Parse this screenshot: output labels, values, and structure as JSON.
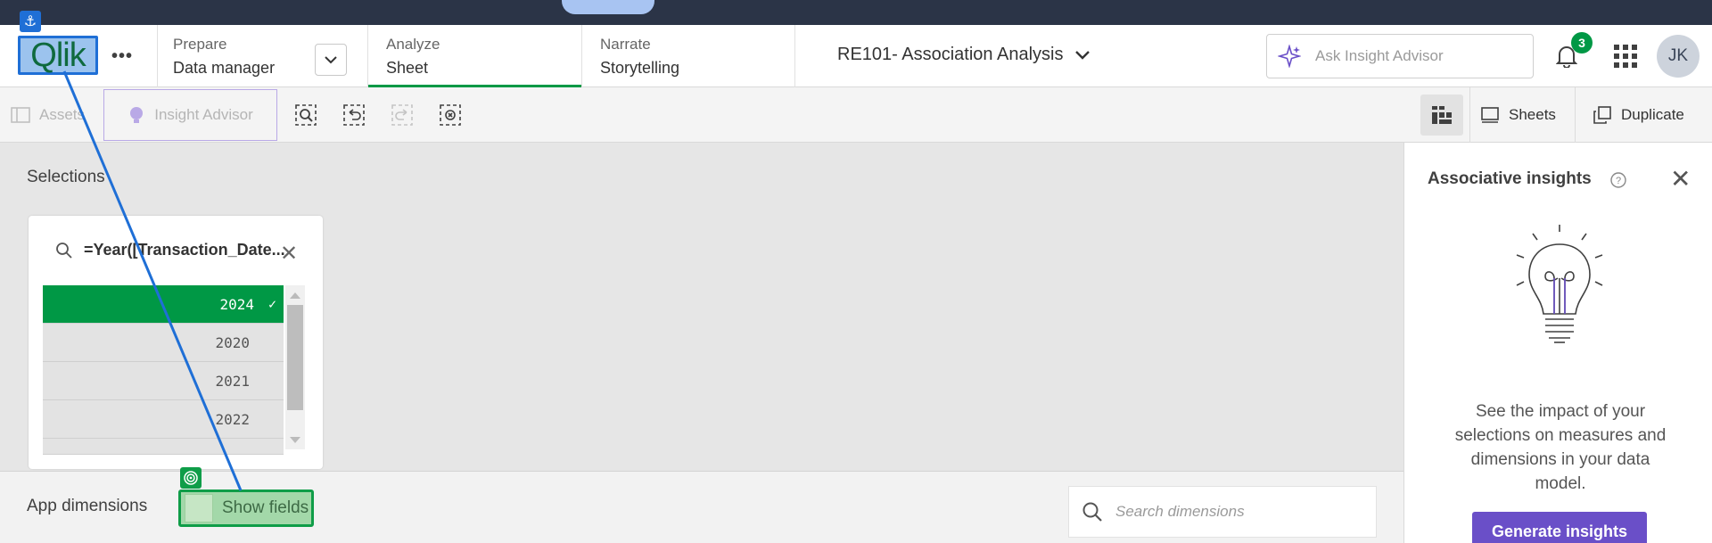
{
  "header": {
    "logo_text": "Qlik",
    "nav": [
      {
        "small": "Prepare",
        "big": "Data manager"
      },
      {
        "small": "Analyze",
        "big": "Sheet"
      },
      {
        "small": "Narrate",
        "big": "Storytelling"
      }
    ],
    "app_title": "RE101- Association Analysis",
    "search_placeholder": "Ask Insight Advisor",
    "notification_count": "3",
    "avatar_initials": "JK"
  },
  "toolbar": {
    "assets_label": "Assets",
    "insight_label": "Insight Advisor",
    "sheets_label": "Sheets",
    "duplicate_label": "Duplicate"
  },
  "selections": {
    "title": "Selections",
    "listbox_title": "=Year([Transaction_Date...",
    "rows": [
      {
        "value": "2024",
        "selected": true
      },
      {
        "value": "2020",
        "selected": false
      },
      {
        "value": "2021",
        "selected": false
      },
      {
        "value": "2022",
        "selected": false
      }
    ]
  },
  "dimensions": {
    "title": "App dimensions",
    "show_fields_label": "Show fields",
    "search_placeholder": "Search dimensions"
  },
  "insights_panel": {
    "title": "Associative insights",
    "description": "See the impact of your selections on measures and dimensions in your data model.",
    "button_label": "Generate insights"
  },
  "colors": {
    "accent_green": "#009845",
    "insight_purple": "#6a4fc8",
    "anchor_blue": "#1f6fd6"
  }
}
